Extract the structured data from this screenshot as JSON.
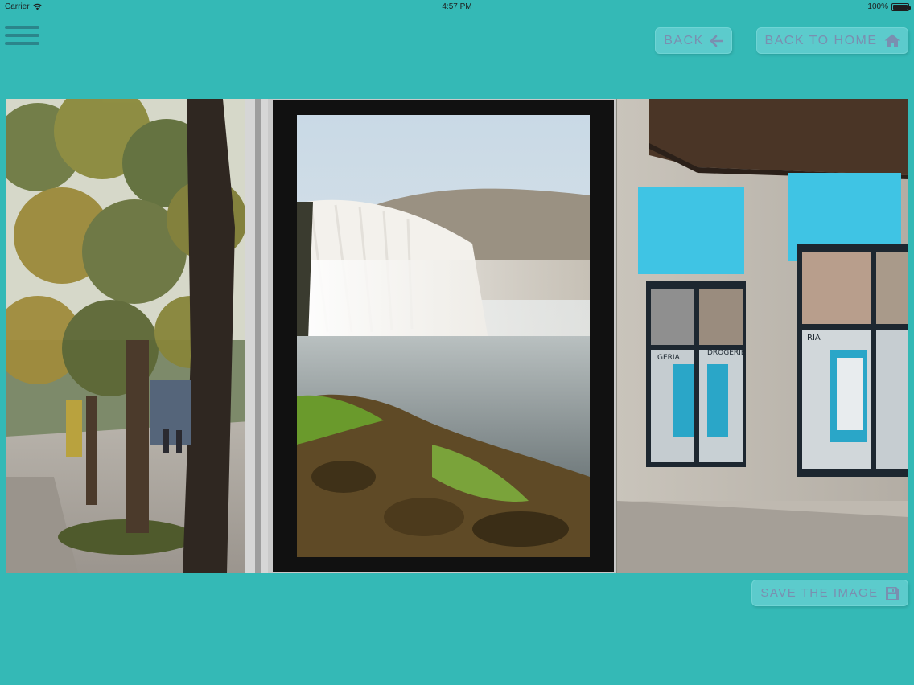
{
  "status_bar": {
    "carrier": "Carrier",
    "time": "4:57 PM",
    "battery": "100%",
    "battery_level": 1.0
  },
  "toolbar": {
    "back_label": "BACK",
    "home_label": "BACK TO HOME",
    "save_label": "SAVE THE IMAGE"
  },
  "poster_texts": {
    "shop_sign_left": "GERIA",
    "shop_sign_right": "DROGERIE",
    "shop_sign_far": "RIA"
  },
  "colors": {
    "background": "#34b9b6",
    "button_bg": "#5ccbcc",
    "button_text": "#7a8fb0"
  }
}
